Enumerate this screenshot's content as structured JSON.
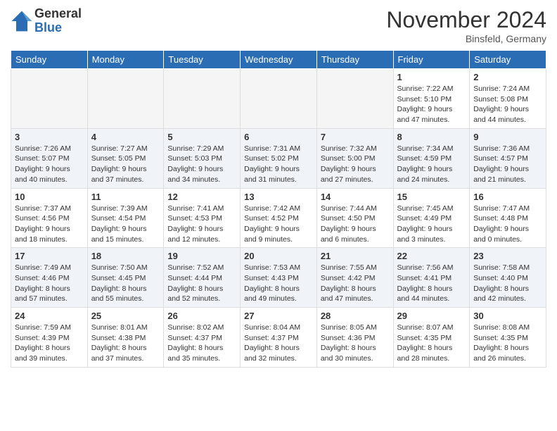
{
  "header": {
    "logo_general": "General",
    "logo_blue": "Blue",
    "month_title": "November 2024",
    "location": "Binsfeld, Germany"
  },
  "weekdays": [
    "Sunday",
    "Monday",
    "Tuesday",
    "Wednesday",
    "Thursday",
    "Friday",
    "Saturday"
  ],
  "weeks": [
    [
      {
        "day": null,
        "info": ""
      },
      {
        "day": null,
        "info": ""
      },
      {
        "day": null,
        "info": ""
      },
      {
        "day": null,
        "info": ""
      },
      {
        "day": null,
        "info": ""
      },
      {
        "day": "1",
        "info": "Sunrise: 7:22 AM\nSunset: 5:10 PM\nDaylight: 9 hours and 47 minutes."
      },
      {
        "day": "2",
        "info": "Sunrise: 7:24 AM\nSunset: 5:08 PM\nDaylight: 9 hours and 44 minutes."
      }
    ],
    [
      {
        "day": "3",
        "info": "Sunrise: 7:26 AM\nSunset: 5:07 PM\nDaylight: 9 hours and 40 minutes."
      },
      {
        "day": "4",
        "info": "Sunrise: 7:27 AM\nSunset: 5:05 PM\nDaylight: 9 hours and 37 minutes."
      },
      {
        "day": "5",
        "info": "Sunrise: 7:29 AM\nSunset: 5:03 PM\nDaylight: 9 hours and 34 minutes."
      },
      {
        "day": "6",
        "info": "Sunrise: 7:31 AM\nSunset: 5:02 PM\nDaylight: 9 hours and 31 minutes."
      },
      {
        "day": "7",
        "info": "Sunrise: 7:32 AM\nSunset: 5:00 PM\nDaylight: 9 hours and 27 minutes."
      },
      {
        "day": "8",
        "info": "Sunrise: 7:34 AM\nSunset: 4:59 PM\nDaylight: 9 hours and 24 minutes."
      },
      {
        "day": "9",
        "info": "Sunrise: 7:36 AM\nSunset: 4:57 PM\nDaylight: 9 hours and 21 minutes."
      }
    ],
    [
      {
        "day": "10",
        "info": "Sunrise: 7:37 AM\nSunset: 4:56 PM\nDaylight: 9 hours and 18 minutes."
      },
      {
        "day": "11",
        "info": "Sunrise: 7:39 AM\nSunset: 4:54 PM\nDaylight: 9 hours and 15 minutes."
      },
      {
        "day": "12",
        "info": "Sunrise: 7:41 AM\nSunset: 4:53 PM\nDaylight: 9 hours and 12 minutes."
      },
      {
        "day": "13",
        "info": "Sunrise: 7:42 AM\nSunset: 4:52 PM\nDaylight: 9 hours and 9 minutes."
      },
      {
        "day": "14",
        "info": "Sunrise: 7:44 AM\nSunset: 4:50 PM\nDaylight: 9 hours and 6 minutes."
      },
      {
        "day": "15",
        "info": "Sunrise: 7:45 AM\nSunset: 4:49 PM\nDaylight: 9 hours and 3 minutes."
      },
      {
        "day": "16",
        "info": "Sunrise: 7:47 AM\nSunset: 4:48 PM\nDaylight: 9 hours and 0 minutes."
      }
    ],
    [
      {
        "day": "17",
        "info": "Sunrise: 7:49 AM\nSunset: 4:46 PM\nDaylight: 8 hours and 57 minutes."
      },
      {
        "day": "18",
        "info": "Sunrise: 7:50 AM\nSunset: 4:45 PM\nDaylight: 8 hours and 55 minutes."
      },
      {
        "day": "19",
        "info": "Sunrise: 7:52 AM\nSunset: 4:44 PM\nDaylight: 8 hours and 52 minutes."
      },
      {
        "day": "20",
        "info": "Sunrise: 7:53 AM\nSunset: 4:43 PM\nDaylight: 8 hours and 49 minutes."
      },
      {
        "day": "21",
        "info": "Sunrise: 7:55 AM\nSunset: 4:42 PM\nDaylight: 8 hours and 47 minutes."
      },
      {
        "day": "22",
        "info": "Sunrise: 7:56 AM\nSunset: 4:41 PM\nDaylight: 8 hours and 44 minutes."
      },
      {
        "day": "23",
        "info": "Sunrise: 7:58 AM\nSunset: 4:40 PM\nDaylight: 8 hours and 42 minutes."
      }
    ],
    [
      {
        "day": "24",
        "info": "Sunrise: 7:59 AM\nSunset: 4:39 PM\nDaylight: 8 hours and 39 minutes."
      },
      {
        "day": "25",
        "info": "Sunrise: 8:01 AM\nSunset: 4:38 PM\nDaylight: 8 hours and 37 minutes."
      },
      {
        "day": "26",
        "info": "Sunrise: 8:02 AM\nSunset: 4:37 PM\nDaylight: 8 hours and 35 minutes."
      },
      {
        "day": "27",
        "info": "Sunrise: 8:04 AM\nSunset: 4:37 PM\nDaylight: 8 hours and 32 minutes."
      },
      {
        "day": "28",
        "info": "Sunrise: 8:05 AM\nSunset: 4:36 PM\nDaylight: 8 hours and 30 minutes."
      },
      {
        "day": "29",
        "info": "Sunrise: 8:07 AM\nSunset: 4:35 PM\nDaylight: 8 hours and 28 minutes."
      },
      {
        "day": "30",
        "info": "Sunrise: 8:08 AM\nSunset: 4:35 PM\nDaylight: 8 hours and 26 minutes."
      }
    ]
  ]
}
